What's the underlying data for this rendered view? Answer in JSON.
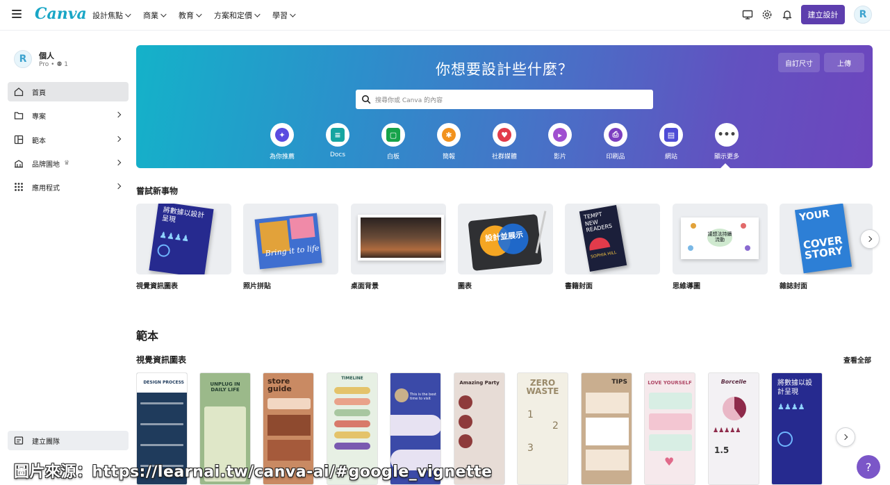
{
  "brand": {
    "logo_text": "Canva",
    "accent": "#5d3eae"
  },
  "nav": {
    "items": [
      {
        "label": "設計焦點"
      },
      {
        "label": "商業"
      },
      {
        "label": "教育"
      },
      {
        "label": "方案和定價"
      },
      {
        "label": "學習"
      }
    ]
  },
  "topbar": {
    "create_button": "建立設計",
    "icons": [
      "desktop-icon",
      "gear-icon",
      "bell-icon"
    ]
  },
  "account": {
    "name": "個人",
    "plan": "Pro",
    "members": "1"
  },
  "sidebar": {
    "items": [
      {
        "label": "首頁",
        "icon": "home-icon",
        "active": true
      },
      {
        "label": "專案",
        "icon": "folder-icon"
      },
      {
        "label": "範本",
        "icon": "template-icon"
      },
      {
        "label": "品牌園地",
        "icon": "brand-icon",
        "crown": "♛"
      },
      {
        "label": "應用程式",
        "icon": "apps-icon"
      }
    ],
    "create_team": "建立團隊"
  },
  "hero": {
    "title": "你想要設計些什麼？",
    "custom_size": "自訂尺寸",
    "upload": "上傳",
    "search_placeholder": "搜尋你或 Canva 的內容",
    "categories": [
      {
        "label": "為你推薦",
        "color": "#5a4be0"
      },
      {
        "label": "Docs",
        "color": "#16a5a1"
      },
      {
        "label": "白板",
        "color": "#16a34a"
      },
      {
        "label": "簡報",
        "color": "#f2921d"
      },
      {
        "label": "社群媒體",
        "color": "#e23b4b"
      },
      {
        "label": "影片",
        "color": "#a04fd0"
      },
      {
        "label": "印刷品",
        "color": "#7c3fc0"
      },
      {
        "label": "網站",
        "color": "#4e4cd6"
      },
      {
        "label": "顯示更多",
        "color": "#555b66"
      }
    ]
  },
  "try_new": {
    "title": "嘗試新事物",
    "items": [
      {
        "label": "視覺資訊圖表"
      },
      {
        "label": "照片拼貼"
      },
      {
        "label": "桌面背景"
      },
      {
        "label": "圖表"
      },
      {
        "label": "書籍封面"
      },
      {
        "label": "思維導圖"
      },
      {
        "label": "雜誌封面"
      }
    ],
    "tile_text": {
      "infographic": "將數據以設計呈現",
      "collage": "Bring it to life",
      "chart": "設計並展示",
      "book": "TEMPT NEW READERS",
      "book_author": "SOPHIA HILL",
      "mindmap": "議想法持續流動",
      "magazine_1": "YOUR",
      "magazine_2": "COVER STORY"
    }
  },
  "templates": {
    "title": "範本",
    "subtitle": "視覺資訊圖表",
    "see_all": "查看全部",
    "items": [
      {
        "headline": "DESIGN PROCESS",
        "bg": "#1f3b5c"
      },
      {
        "headline": "UNPLUG IN DAILY LIFE",
        "bg": "#9bb98a"
      },
      {
        "headline": "store guide",
        "bg": "#c98a63"
      },
      {
        "headline": "TIMELINE",
        "bg": "#e7f0e4"
      },
      {
        "headline": "This is the best time to visit",
        "bg": "#3b4aa8"
      },
      {
        "headline": "Amazing Party",
        "bg": "#e7dcd6"
      },
      {
        "headline": "ZERO WASTE",
        "bg": "#f2efe4"
      },
      {
        "headline": "TIPS",
        "bg": "#c9ae8f"
      },
      {
        "headline": "LOVE YOURSELF",
        "bg": "#f6e9ec"
      },
      {
        "headline": "Borcelle",
        "bg": "#f3f1f4"
      },
      {
        "headline": "將數據以設計呈現",
        "bg": "#262a8f"
      }
    ]
  },
  "help": "?",
  "watermark": "圖片來源：https://learnai.tw/canva-ai/#google_vignette"
}
